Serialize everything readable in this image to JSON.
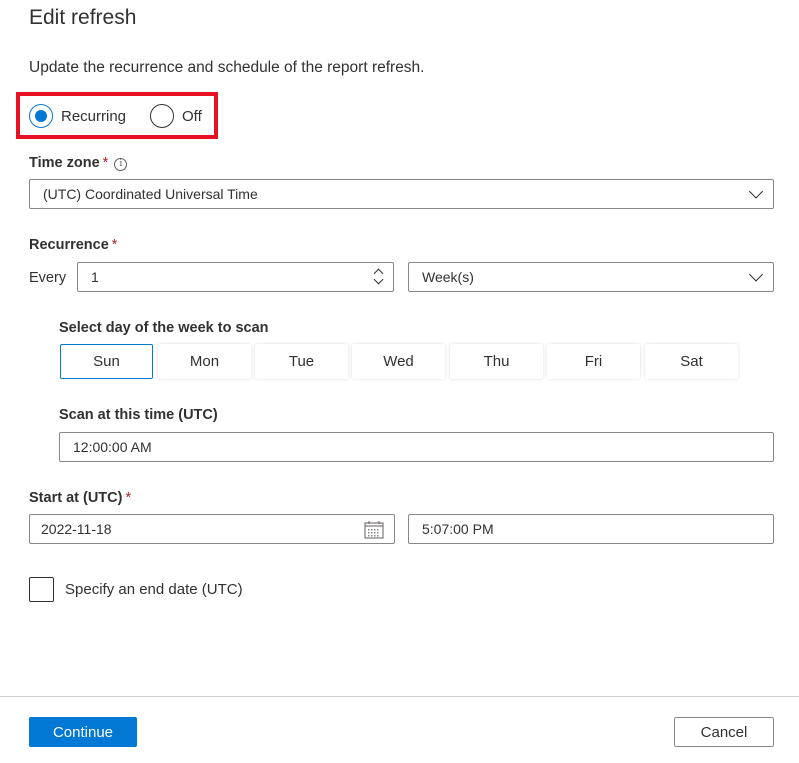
{
  "dialog": {
    "title": "Edit refresh",
    "subtitle": "Update the recurrence and schedule of the report refresh."
  },
  "mode": {
    "options": [
      {
        "label": "Recurring",
        "checked": true
      },
      {
        "label": "Off",
        "checked": false
      }
    ],
    "highlight_color": "#e81123"
  },
  "time_zone": {
    "label": "Time zone",
    "required_mark": "*",
    "info_icon": "info-icon",
    "info_glyph": "i",
    "value": "(UTC) Coordinated Universal Time"
  },
  "recurrence": {
    "label": "Recurrence",
    "required_mark": "*",
    "every_label": "Every",
    "interval_value": "1",
    "unit_value": "Week(s)"
  },
  "day_of_week": {
    "label": "Select day of the week to scan",
    "days": [
      {
        "label": "Sun",
        "selected": true
      },
      {
        "label": "Mon",
        "selected": false
      },
      {
        "label": "Tue",
        "selected": false
      },
      {
        "label": "Wed",
        "selected": false
      },
      {
        "label": "Thu",
        "selected": false
      },
      {
        "label": "Fri",
        "selected": false
      },
      {
        "label": "Sat",
        "selected": false
      }
    ]
  },
  "scan_time": {
    "label": "Scan at this time (UTC)",
    "value": "12:00:00 AM"
  },
  "start": {
    "label": "Start at (UTC)",
    "required_mark": "*",
    "date_value": "2022-11-18",
    "time_value": "5:07:00 PM"
  },
  "end_date": {
    "label": "Specify an end date (UTC)",
    "checked": false
  },
  "footer": {
    "continue_label": "Continue",
    "cancel_label": "Cancel"
  },
  "colors": {
    "accent": "#0078d4",
    "required": "#a4262c",
    "text": "#323130"
  }
}
